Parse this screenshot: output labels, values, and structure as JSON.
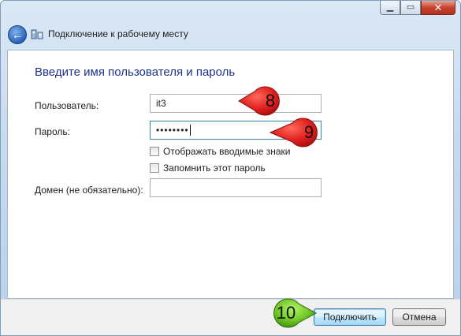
{
  "window": {
    "title": "Подключение к рабочему месту",
    "controls": {
      "minimize_icon": "minimize-icon",
      "maximize_icon": "maximize-icon",
      "close_icon": "close-icon"
    }
  },
  "form": {
    "heading": "Введите имя пользователя и пароль",
    "username_label": "Пользователь:",
    "username_value": "it3",
    "password_label": "Пароль:",
    "password_value": "••••••••",
    "show_chars_label": "Отображать вводимые знаки",
    "show_chars_checked": false,
    "remember_label": "Запомнить этот пароль",
    "remember_checked": false,
    "domain_label": "Домен (не обязательно):",
    "domain_value": ""
  },
  "footer": {
    "connect_label": "Подключить",
    "cancel_label": "Отмена"
  },
  "annotations": {
    "marker_username": "8",
    "marker_password": "9",
    "marker_connect": "10",
    "marker_red": "#e02020",
    "marker_green": "#6cc524"
  }
}
